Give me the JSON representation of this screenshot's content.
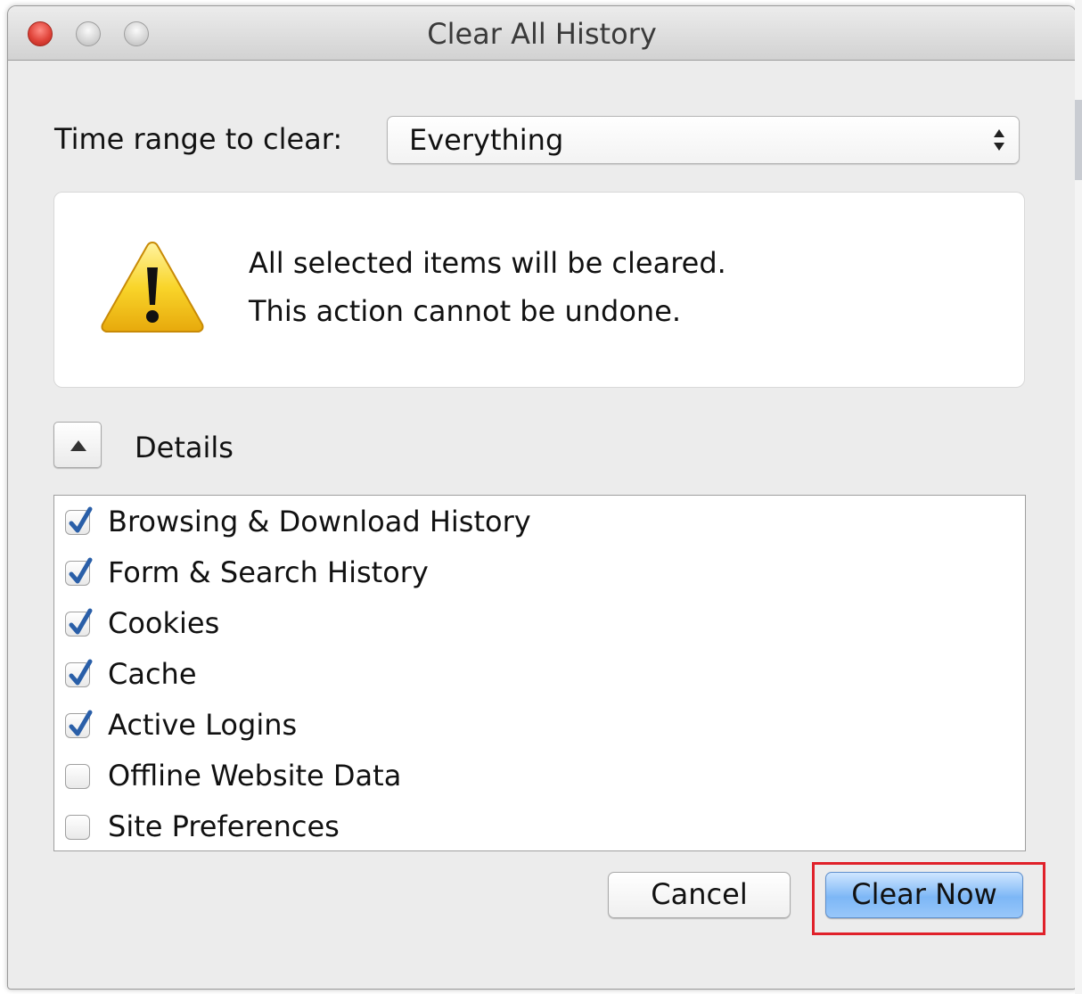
{
  "window": {
    "title": "Clear All History"
  },
  "time_range": {
    "label": "Time range to clear:",
    "selected": "Everything"
  },
  "warning": {
    "line1": "All selected items will be cleared.",
    "line2": "This action cannot be undone."
  },
  "details": {
    "label": "Details",
    "expanded": true
  },
  "items": [
    {
      "label": "Browsing & Download History",
      "checked": true
    },
    {
      "label": "Form & Search History",
      "checked": true
    },
    {
      "label": "Cookies",
      "checked": true
    },
    {
      "label": "Cache",
      "checked": true
    },
    {
      "label": "Active Logins",
      "checked": true
    },
    {
      "label": "Offline Website Data",
      "checked": false
    },
    {
      "label": "Site Preferences",
      "checked": false
    }
  ],
  "buttons": {
    "cancel": "Cancel",
    "clear_now": "Clear Now"
  },
  "colors": {
    "highlight": "#e0212a",
    "checkmark": "#2a5fa8",
    "primary_button": "#7db7f6"
  }
}
